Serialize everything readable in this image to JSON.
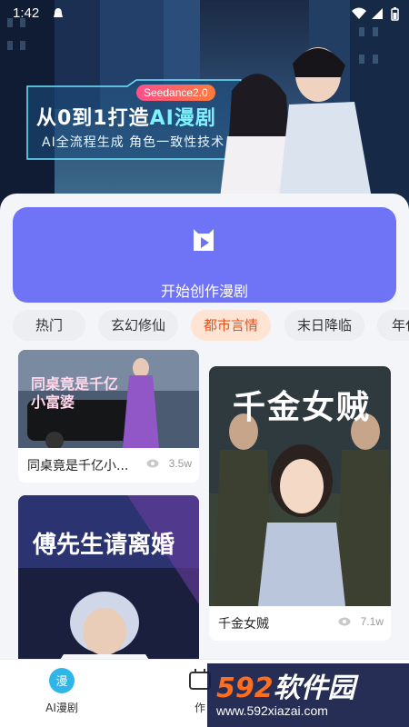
{
  "status_bar": {
    "time": "1:42",
    "icons": [
      "notification-icon",
      "wifi-icon",
      "signal-icon",
      "battery-icon"
    ]
  },
  "hero": {
    "tag": "Seedance2.0",
    "title_prefix": "从0到1打造",
    "title_highlight": "AI漫剧",
    "subtitle": "AI全流程生成 角色一致性技术"
  },
  "create": {
    "label": "开始创作漫剧",
    "icon": "camera-icon"
  },
  "tabs": [
    {
      "label": "热门",
      "active": false
    },
    {
      "label": "玄幻修仙",
      "active": false
    },
    {
      "label": "都市言情",
      "active": true
    },
    {
      "label": "末日降临",
      "active": false
    },
    {
      "label": "年代",
      "active": false
    }
  ],
  "cards": [
    {
      "title": "同桌竟是千亿小...",
      "views": "3.5w",
      "poster_text": "同桌竟是千亿\n小富婆"
    },
    {
      "title": "千金女贼",
      "views": "7.1w",
      "poster_text": "千金女贼"
    },
    {
      "title": "",
      "views": "",
      "poster_text": "傅先生请离婚"
    }
  ],
  "nav": [
    {
      "label": "AI漫剧",
      "icon": "manga-icon"
    },
    {
      "label": "作",
      "icon": "create-icon"
    }
  ],
  "watermark": {
    "digits": "592",
    "text": "软件园",
    "url": "www.592xiazai.com"
  },
  "colors": {
    "accent": "#6f73f5",
    "tab_active_bg": "#ffe3d3",
    "tab_active_text": "#e4541b"
  }
}
